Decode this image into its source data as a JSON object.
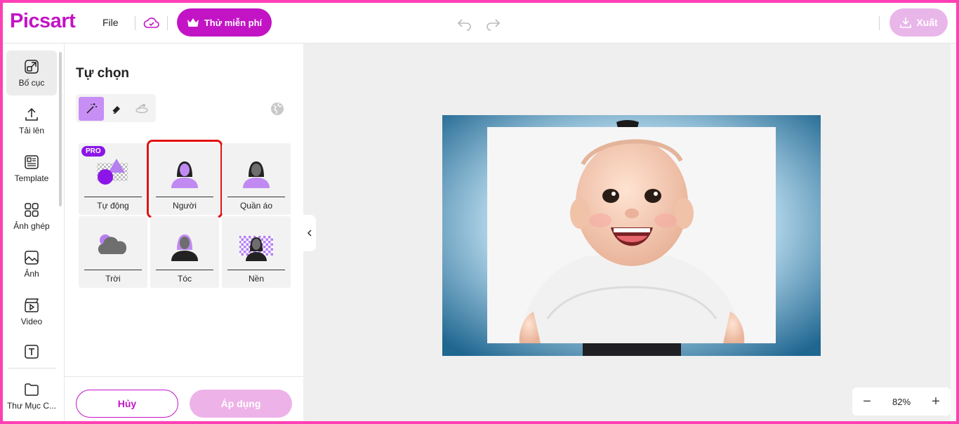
{
  "app": {
    "logo": "Picsart"
  },
  "topbar": {
    "file_label": "File",
    "try_free_label": "Thử miễn phí",
    "export_label": "Xuất"
  },
  "rail": {
    "items": [
      {
        "label": "Bố cục",
        "icon": "layout-icon",
        "active": true
      },
      {
        "label": "Tải lên",
        "icon": "upload-icon"
      },
      {
        "label": "Template",
        "icon": "template-icon"
      },
      {
        "label": "Ảnh ghép",
        "icon": "collage-icon"
      },
      {
        "label": "Ảnh",
        "icon": "photo-icon"
      },
      {
        "label": "Video",
        "icon": "video-icon"
      },
      {
        "label": "",
        "icon": "text-icon"
      },
      {
        "label": "Thư Mục C...",
        "icon": "folder-icon"
      }
    ]
  },
  "panel": {
    "title": "Tự chọn",
    "tools": [
      "magic-wand-icon",
      "eraser-icon",
      "restore-brush-icon"
    ],
    "options": [
      {
        "label": "Tự động",
        "pro": "PRO"
      },
      {
        "label": "Người",
        "selected": true
      },
      {
        "label": "Quần áo"
      },
      {
        "label": "Trời"
      },
      {
        "label": "Tóc"
      },
      {
        "label": "Nền"
      }
    ],
    "cancel_label": "Hủy",
    "apply_label": "Áp dụng"
  },
  "zoom": {
    "value": "82%",
    "minus": "−",
    "plus": "+"
  },
  "colors": {
    "brand": "#c214c5",
    "accent_light": "#c78ff5",
    "selection": "#e01414"
  }
}
